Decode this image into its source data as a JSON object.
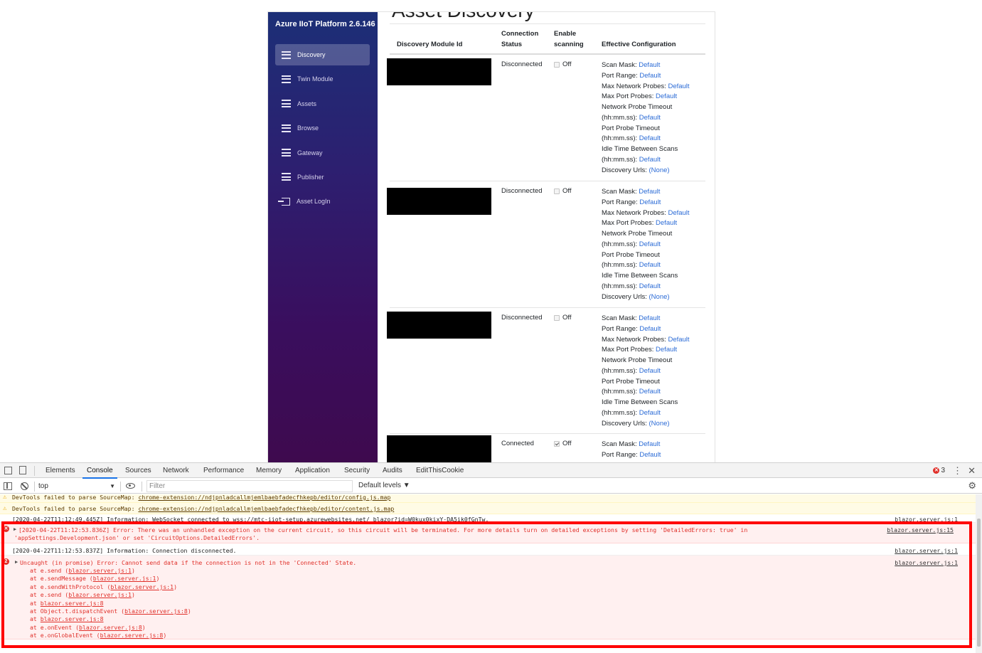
{
  "app": {
    "page_title": "Asset Discovery",
    "brand": "Azure IIoT Platform 2.6.146",
    "nav": [
      {
        "label": "Discovery",
        "icon": "list-icon",
        "active": true
      },
      {
        "label": "Twin Module",
        "icon": "list-icon",
        "active": false
      },
      {
        "label": "Assets",
        "icon": "list-icon",
        "active": false
      },
      {
        "label": "Browse",
        "icon": "list-icon",
        "active": false
      },
      {
        "label": "Gateway",
        "icon": "bullet-list-icon",
        "active": false
      },
      {
        "label": "Publisher",
        "icon": "bullet-list-icon",
        "active": false
      },
      {
        "label": "Asset LogIn",
        "icon": "login-icon",
        "active": false
      }
    ],
    "table": {
      "headers": {
        "id": "Discovery Module Id",
        "conn_line1": "Connection",
        "conn_line2": "Status",
        "scan_line1": "Enable",
        "scan_line2": "scanning",
        "cfg": "Effective Configuration"
      },
      "rows": [
        {
          "status": "Disconnected",
          "scan_checked": false,
          "scan_label": "Off",
          "config": [
            {
              "label": "Scan Mask: ",
              "value": "Default"
            },
            {
              "label": "Port Range: ",
              "value": "Default"
            },
            {
              "label": "Max Network Probes: ",
              "value": "Default"
            },
            {
              "label": "Max Port Probes: ",
              "value": "Default"
            },
            {
              "label": "Network Probe Timeout",
              "value": ""
            },
            {
              "label": "(hh:mm.ss): ",
              "value": "Default"
            },
            {
              "label": "Port Probe Timeout",
              "value": ""
            },
            {
              "label": "(hh:mm.ss): ",
              "value": "Default"
            },
            {
              "label": "Idle Time Between Scans",
              "value": ""
            },
            {
              "label": "(hh:mm.ss): ",
              "value": "Default"
            },
            {
              "label": "Discovery Urls: ",
              "value": "(None)"
            }
          ]
        },
        {
          "status": "Disconnected",
          "scan_checked": false,
          "scan_label": "Off",
          "config": [
            {
              "label": "Scan Mask: ",
              "value": "Default"
            },
            {
              "label": "Port Range: ",
              "value": "Default"
            },
            {
              "label": "Max Network Probes: ",
              "value": "Default"
            },
            {
              "label": "Max Port Probes: ",
              "value": "Default"
            },
            {
              "label": "Network Probe Timeout",
              "value": ""
            },
            {
              "label": "(hh:mm.ss): ",
              "value": "Default"
            },
            {
              "label": "Port Probe Timeout",
              "value": ""
            },
            {
              "label": "(hh:mm.ss): ",
              "value": "Default"
            },
            {
              "label": "Idle Time Between Scans",
              "value": ""
            },
            {
              "label": "(hh:mm.ss): ",
              "value": "Default"
            },
            {
              "label": "Discovery Urls: ",
              "value": "(None)"
            }
          ]
        },
        {
          "status": "Disconnected",
          "scan_checked": false,
          "scan_label": "Off",
          "config": [
            {
              "label": "Scan Mask: ",
              "value": "Default"
            },
            {
              "label": "Port Range: ",
              "value": "Default"
            },
            {
              "label": "Max Network Probes: ",
              "value": "Default"
            },
            {
              "label": "Max Port Probes: ",
              "value": "Default"
            },
            {
              "label": "Network Probe Timeout",
              "value": ""
            },
            {
              "label": "(hh:mm.ss): ",
              "value": "Default"
            },
            {
              "label": "Port Probe Timeout",
              "value": ""
            },
            {
              "label": "(hh:mm.ss): ",
              "value": "Default"
            },
            {
              "label": "Idle Time Between Scans",
              "value": ""
            },
            {
              "label": "(hh:mm.ss): ",
              "value": "Default"
            },
            {
              "label": "Discovery Urls: ",
              "value": "(None)"
            }
          ]
        },
        {
          "status": "Connected",
          "scan_checked": true,
          "scan_label": "Off",
          "config": [
            {
              "label": "Scan Mask: ",
              "value": "Default"
            },
            {
              "label": "Port Range: ",
              "value": "Default"
            }
          ]
        }
      ]
    }
  },
  "devtools": {
    "tabs": [
      "Elements",
      "Console",
      "Sources",
      "Network",
      "Performance",
      "Memory",
      "Application",
      "Security",
      "Audits",
      "EditThisCookie"
    ],
    "active_tab": "Console",
    "error_count": "3",
    "context": "top",
    "filter_placeholder": "Filter",
    "levels": "Default levels ▼",
    "lines": {
      "warn1": "DevTools failed to parse SourceMap: ",
      "warn1_link": "chrome-extension://ndjpnladcallmjemlbaebfadecfhkepb/editor/config.js.map",
      "warn2": "DevTools failed to parse SourceMap: ",
      "warn2_link": "chrome-extension://ndjpnladcallmjemlbaebfadecfhkepb/editor/content.js.map",
      "info1": "[2020-04-22T11:12:49.445Z] Information: WebSocket connected to wss://mtc-iiot-setup.azurewebsites.net/_blazor?id=W0kux0kixY-DA5ik0fGnTw.",
      "info1_src": "blazor.server.js:1",
      "err1_line1": "[2020-04-22T11:12:53.836Z] Error: There was an unhandled exception on the current circuit, so this circuit will be terminated. For more details turn on detailed exceptions by setting 'DetailedErrors: true' in",
      "err1_line2": "'appSettings.Development.json' or set 'CircuitOptions.DetailedErrors'.",
      "err1_src": "blazor.server.js:15",
      "info2": "[2020-04-22T11:12:53.837Z] Information: Connection disconnected.",
      "info2_src": "blazor.server.js:1",
      "err2": "Uncaught (in promise) Error: Cannot send data if the connection is not in the 'Connected' State.",
      "err2_src": "blazor.server.js:1",
      "err2_count": "2",
      "stack": [
        {
          "fn": "at e.send (",
          "link": "blazor.server.js:1",
          "close": ")"
        },
        {
          "fn": "at e.sendMessage (",
          "link": "blazor.server.js:1",
          "close": ")"
        },
        {
          "fn": "at e.sendWithProtocol (",
          "link": "blazor.server.js:1",
          "close": ")"
        },
        {
          "fn": "at e.send (",
          "link": "blazor.server.js:1",
          "close": ")"
        },
        {
          "fn": "at ",
          "link": "blazor.server.js:8",
          "close": ""
        },
        {
          "fn": "at Object.t.dispatchEvent (",
          "link": "blazor.server.js:8",
          "close": ")"
        },
        {
          "fn": "at ",
          "link": "blazor.server.js:8",
          "close": ""
        },
        {
          "fn": "at e.onEvent (",
          "link": "blazor.server.js:8",
          "close": ")"
        },
        {
          "fn": "at e.onGlobalEvent (",
          "link": "blazor.server.js:8",
          "close": ")"
        }
      ]
    }
  },
  "colors": {
    "link": "#2b6bd6",
    "error": "#e0302a",
    "highlight": "#ff0000"
  }
}
